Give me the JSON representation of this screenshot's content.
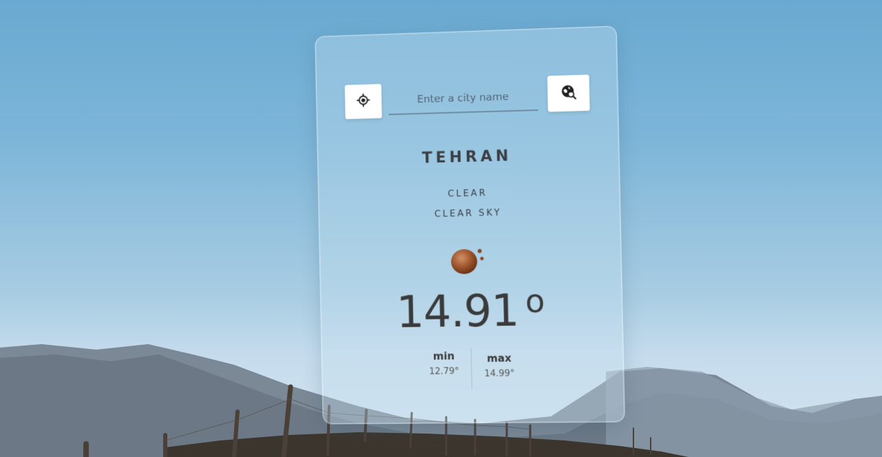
{
  "search": {
    "placeholder": "Enter a city name",
    "value": ""
  },
  "icons": {
    "locate": "crosshair-icon",
    "search": "globe-search-icon",
    "weather": "clear-sky-sun-icon"
  },
  "weather": {
    "city": "TEHRAN",
    "main": "CLEAR",
    "description": "CLEAR SKY",
    "temperature": "14.91",
    "degree_symbol": "o",
    "min_label": "min",
    "min_value": "12.79°",
    "max_label": "max",
    "max_value": "14.99°"
  },
  "colors": {
    "sky_top": "#6aa9d1",
    "sky_bottom": "#d3e3ef",
    "text": "#3b3f44",
    "button_bg": "#ffffff"
  }
}
